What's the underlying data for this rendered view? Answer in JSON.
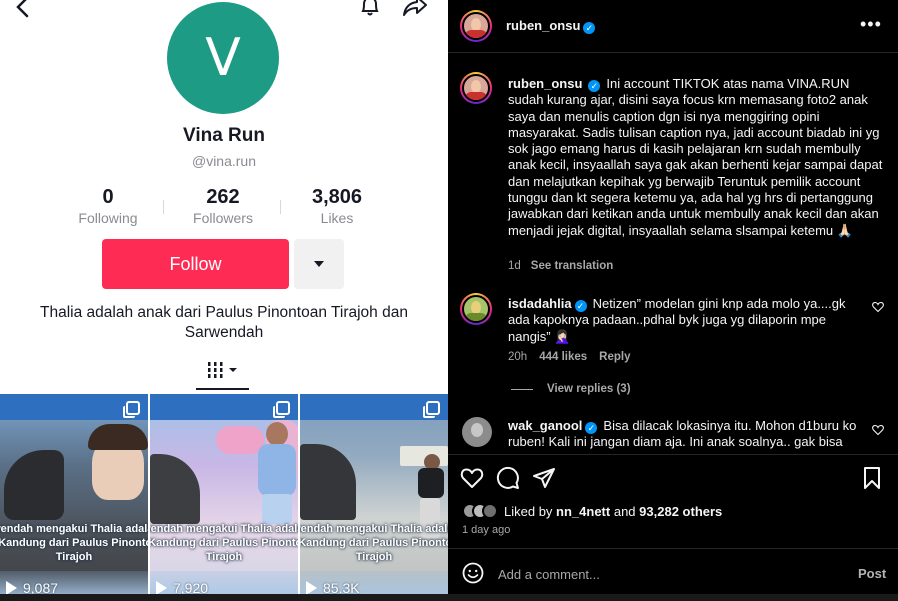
{
  "tiktok": {
    "avatar_letter": "V",
    "avatar_color": "#1d9b85",
    "name": "Vina Run",
    "handle": "@vina.run",
    "stats": [
      {
        "value": "0",
        "label": "Following"
      },
      {
        "value": "262",
        "label": "Followers"
      },
      {
        "value": "3,806",
        "label": "Likes"
      }
    ],
    "follow_label": "Follow",
    "accent": "#fe2c55",
    "bio": "Thalia adalah anak dari Paulus Pinontoan Tirajoh dan Sarwendah",
    "videos": [
      {
        "caption_1": "rwendah mengakui Thalia adalah",
        "caption_2": "ak Kandung dari Paulus Pinontoan",
        "caption_3": "Tirajoh",
        "plays": "9,087"
      },
      {
        "caption_1": "rwendah mengakui Thalia adalah",
        "caption_2": "ak Kandung dari Paulus Pinontoan",
        "caption_3": "Tirajoh",
        "plays": "7,920"
      },
      {
        "caption_1": "rwendah mengakui Thalia adalah",
        "caption_2": "ak Kandung dari Paulus Pinontoan",
        "caption_3": "Tirajoh",
        "plays": "85.3K"
      }
    ]
  },
  "instagram": {
    "header_username": "ruben_onsu",
    "caption": {
      "username": "ruben_onsu",
      "text": "Ini account TIKTOK atas nama VINA.RUN sudah kurang ajar, disini saya focus krn memasang foto2 anak saya dan menulis caption dgn isi nya menggiring opini masyarakat. Sadis tulisan caption nya, jadi account biadab ini yg sok jago emang harus di kasih pelajaran krn sudah membully anak kecil, insyaallah saya gak akan berhenti kejar sampai dapat dan melajutkan kepihak yg berwajib Teruntuk pemilik account tunggu dan kt segera ketemu ya, ada hal yg hrs di pertanggung jawabkan dari ketikan anda untuk membully anak kecil dan akan menjadi jejak digital, insyaallah selama slsampai ketemu 🙏🏻",
      "time": "1d",
      "translate": "See translation"
    },
    "comments": [
      {
        "username": "isdadahlia",
        "text": "Netizen” modelan gini knp ada molo ya....gk ada kapoknya padaan..pdhal byk juga yg dilaporin mpe nangis” 🤦🏻‍♀️",
        "time": "20h",
        "likes": "444 likes",
        "reply": "Reply",
        "view_replies": "View replies (3)"
      },
      {
        "username": "wak_ganool",
        "text": "Bisa dilacak lokasinya itu. Mohon d1buru ko ruben! Kali ini jangan diam aja. Ini anak soalnya.. gak bisa dibiarin"
      }
    ],
    "liked_by_prefix": "Liked by",
    "liked_by_user": "nn_4nett",
    "liked_by_and": "and",
    "liked_by_others": "93,282 others",
    "posted_ago": "1 day ago",
    "comment_placeholder": "Add a comment...",
    "post_label": "Post"
  }
}
